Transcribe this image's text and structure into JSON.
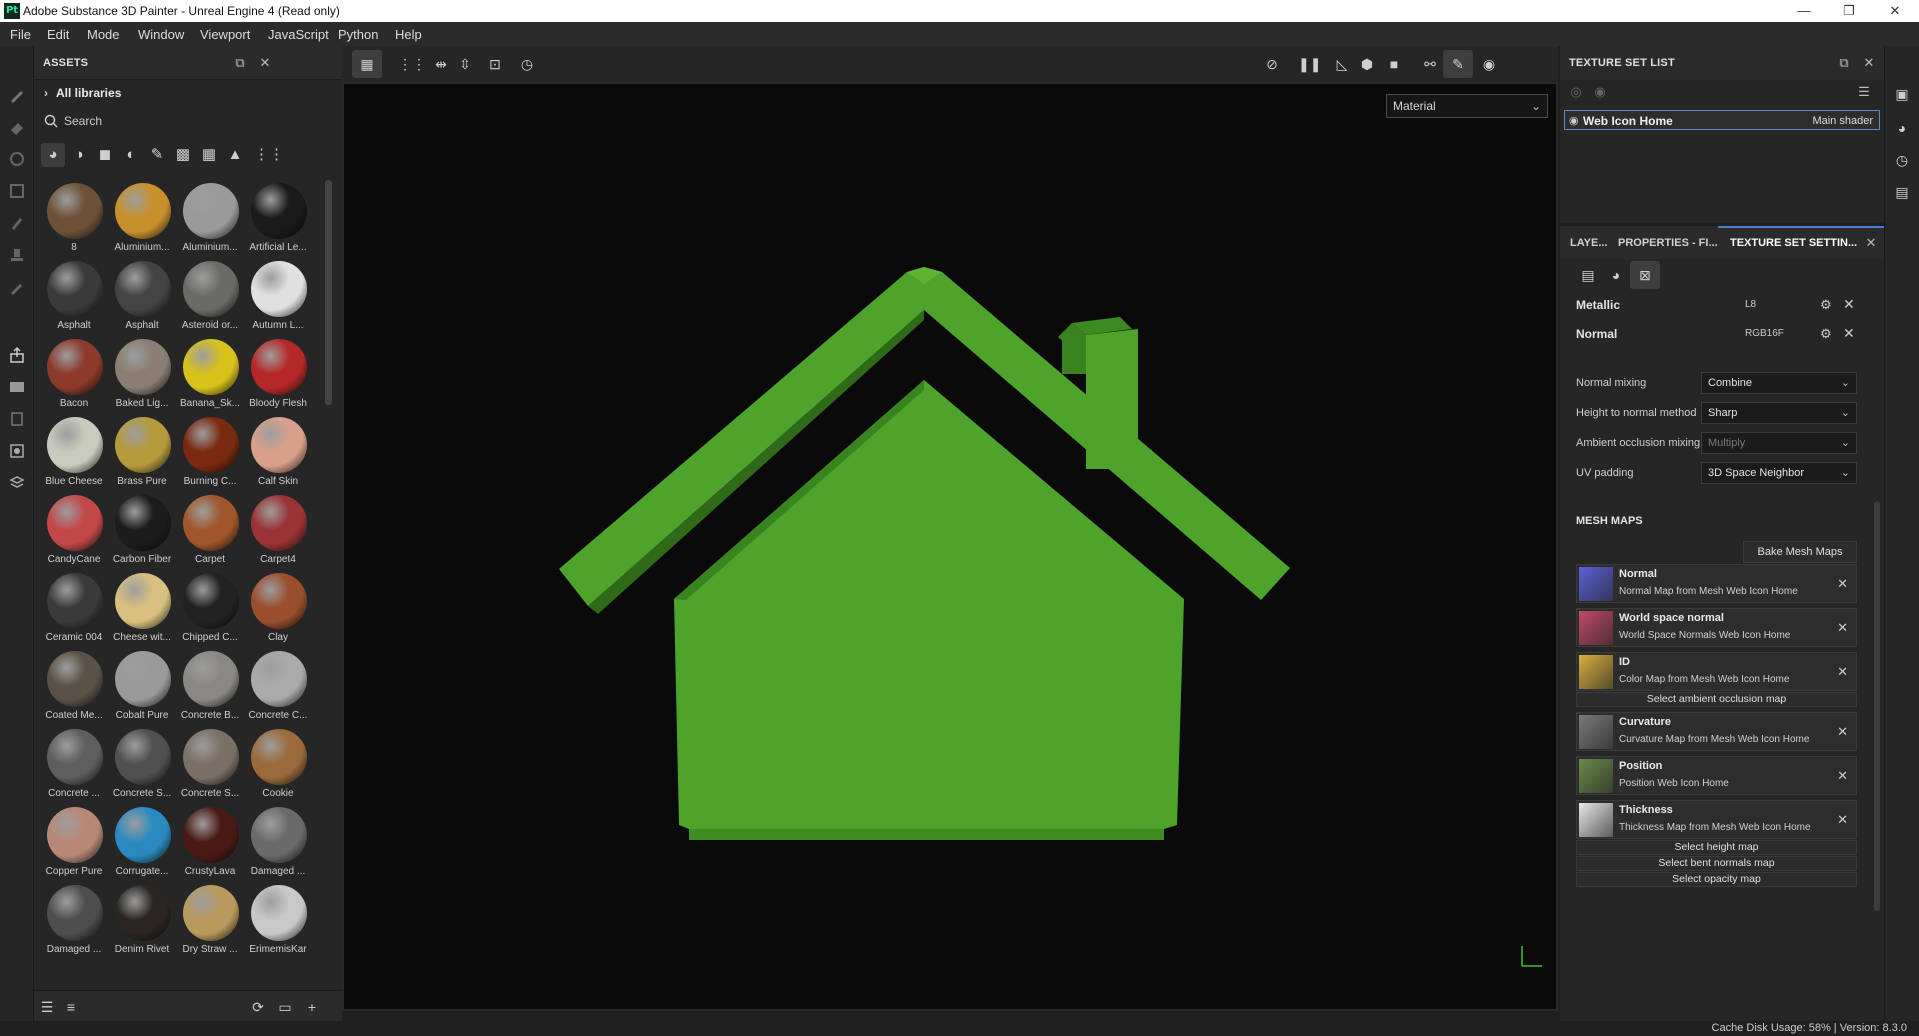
{
  "window": {
    "title": "Adobe Substance 3D Painter - Unreal Engine 4 (Read only)",
    "app_badge": "Pt",
    "minimize": "—",
    "maximize": "❐",
    "close": "✕"
  },
  "menu": [
    "File",
    "Edit",
    "Mode",
    "Window",
    "Viewport",
    "JavaScript",
    "Python",
    "Help"
  ],
  "assets": {
    "title": "ASSETS",
    "all_libraries": "All libraries",
    "search_placeholder": "Search",
    "materials": [
      {
        "label": "8",
        "color": "#6e5238"
      },
      {
        "label": "Aluminium...",
        "color": "#c8902c"
      },
      {
        "label": "Aluminium...",
        "color": "#9a9a9a"
      },
      {
        "label": "Artificial Le...",
        "color": "#1a1a1a"
      },
      {
        "label": "Asphalt",
        "color": "#3a3a3a"
      },
      {
        "label": "Asphalt",
        "color": "#444444"
      },
      {
        "label": "Asteroid or...",
        "color": "#6b6b66"
      },
      {
        "label": "Autumn L...",
        "color": "#e0e0e0"
      },
      {
        "label": "Bacon",
        "color": "#8c3a2c"
      },
      {
        "label": "Baked Lig...",
        "color": "#8a7e72"
      },
      {
        "label": "Banana_Sk...",
        "color": "#d8c21c"
      },
      {
        "label": "Bloody Flesh",
        "color": "#b62828"
      },
      {
        "label": "Blue Cheese",
        "color": "#c8cabc"
      },
      {
        "label": "Brass Pure",
        "color": "#b59b3c"
      },
      {
        "label": "Burning C...",
        "color": "#7a2a10"
      },
      {
        "label": "Calf Skin",
        "color": "#d8a08a"
      },
      {
        "label": "CandyCane",
        "color": "#c24848"
      },
      {
        "label": "Carbon Fiber",
        "color": "#1c1c1c"
      },
      {
        "label": "Carpet",
        "color": "#a0562a"
      },
      {
        "label": "Carpet4",
        "color": "#9a3434"
      },
      {
        "label": "Ceramic 004",
        "color": "#3a3a3a"
      },
      {
        "label": "Cheese wit...",
        "color": "#d8c080"
      },
      {
        "label": "Chipped C...",
        "color": "#222222"
      },
      {
        "label": "Clay",
        "color": "#9a4e2e"
      },
      {
        "label": "Coated Me...",
        "color": "#5a5246"
      },
      {
        "label": "Cobalt Pure",
        "color": "#9a9a9a"
      },
      {
        "label": "Concrete B...",
        "color": "#8a8884"
      },
      {
        "label": "Concrete C...",
        "color": "#aaaaaa"
      },
      {
        "label": "Concrete ...",
        "color": "#5e5e5e"
      },
      {
        "label": "Concrete S...",
        "color": "#505050"
      },
      {
        "label": "Concrete S...",
        "color": "#7a7066"
      },
      {
        "label": "Cookie",
        "color": "#9a6a3a"
      },
      {
        "label": "Copper Pure",
        "color": "#b88876"
      },
      {
        "label": "Corrugate...",
        "color": "#2a8ac0"
      },
      {
        "label": "CrustyLava",
        "color": "#4a1a14"
      },
      {
        "label": "Damaged ...",
        "color": "#6a6a6a"
      },
      {
        "label": "Damaged ...",
        "color": "#4e4e4e"
      },
      {
        "label": "Denim Rivet",
        "color": "#2a2622"
      },
      {
        "label": "Dry Straw ...",
        "color": "#b89a5c"
      },
      {
        "label": "ErimemisKar",
        "color": "#c8c8c8"
      }
    ]
  },
  "viewport": {
    "display_mode": "Material"
  },
  "texture_set_list": {
    "title": "TEXTURE SET LIST",
    "items": [
      {
        "name": "Web Icon Home",
        "shader": "Main shader"
      }
    ]
  },
  "tabs": [
    "LAYE...",
    "PROPERTIES - FI...",
    "TEXTURE SET SETTIN..."
  ],
  "settings": {
    "channels": [
      {
        "name": "Metallic",
        "format": "L8"
      },
      {
        "name": "Normal",
        "format": "RGB16F"
      }
    ],
    "props": [
      {
        "label": "Normal mixing",
        "value": "Combine",
        "disabled": false
      },
      {
        "label": "Height to normal method",
        "value": "Sharp",
        "disabled": false
      },
      {
        "label": "Ambient occlusion mixing",
        "value": "Multiply",
        "disabled": true
      },
      {
        "label": "UV padding",
        "value": "3D Space Neighbor",
        "disabled": false
      }
    ],
    "mesh_maps_title": "MESH MAPS",
    "bake_button": "Bake Mesh Maps",
    "maps": [
      {
        "kind": "slot",
        "title": "Normal",
        "subtitle": "Normal Map from Mesh Web Icon Home",
        "thumb": "#5a62d8"
      },
      {
        "kind": "slot",
        "title": "World space normal",
        "subtitle": "World Space Normals Web Icon Home",
        "thumb": "#c04a68"
      },
      {
        "kind": "slot",
        "title": "ID",
        "subtitle": "Color Map from Mesh Web Icon Home",
        "thumb": "#d8b040"
      },
      {
        "kind": "button",
        "title": "Select ambient occlusion map"
      },
      {
        "kind": "slot",
        "title": "Curvature",
        "subtitle": "Curvature Map from Mesh Web Icon Home",
        "thumb": "#7a7a7a"
      },
      {
        "kind": "slot",
        "title": "Position",
        "subtitle": "Position Web Icon Home",
        "thumb": "#6a8a4a"
      },
      {
        "kind": "slot",
        "title": "Thickness",
        "subtitle": "Thickness Map from Mesh Web Icon Home",
        "thumb": "#e8e8e8"
      },
      {
        "kind": "button",
        "title": "Select height map"
      },
      {
        "kind": "button",
        "title": "Select bent normals map"
      },
      {
        "kind": "button",
        "title": "Select opacity map"
      }
    ]
  },
  "status": "Cache Disk Usage:   58% | Version: 8.3.0",
  "colors": {
    "accent": "#4a7fd0",
    "house_green": "#4ea32a"
  }
}
